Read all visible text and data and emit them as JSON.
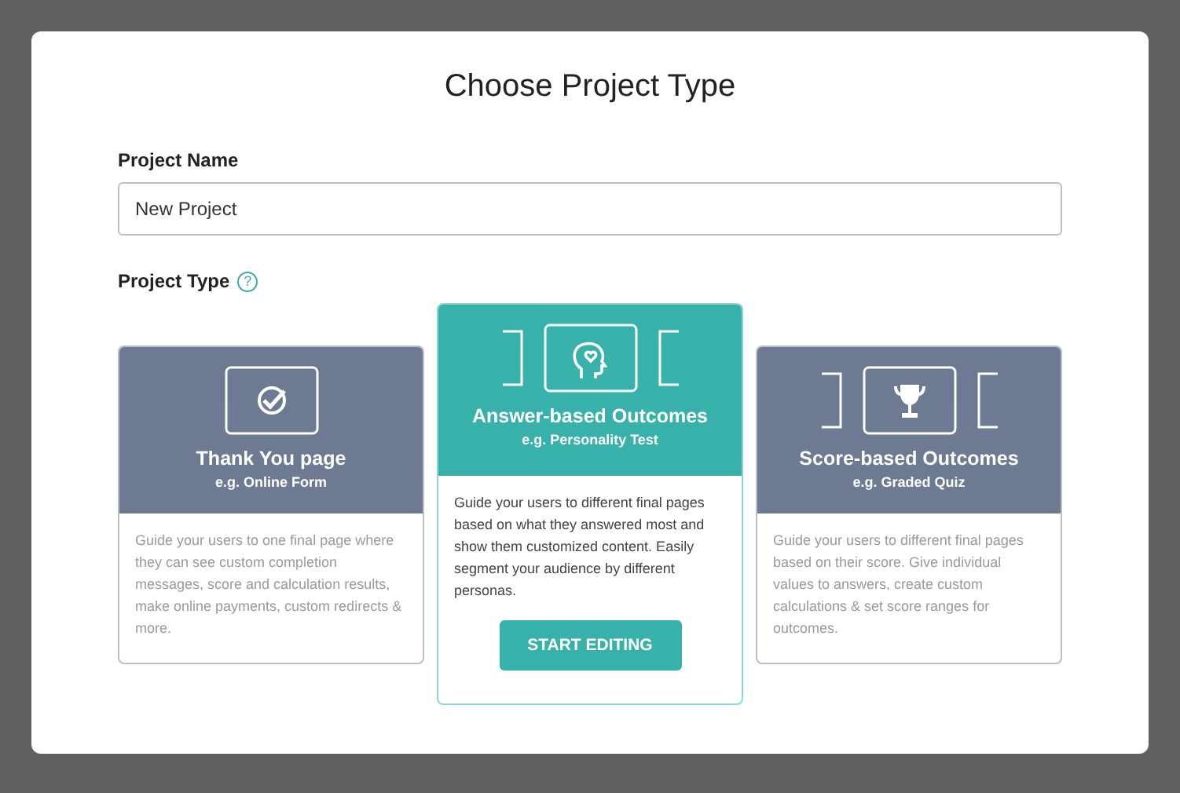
{
  "dialog": {
    "title": "Choose Project Type"
  },
  "project_name": {
    "label": "Project Name",
    "value": "New Project"
  },
  "project_type": {
    "label": "Project Type",
    "help": "?"
  },
  "types": [
    {
      "kind": "check",
      "title": "Thank You page",
      "example": "e.g. Online Form",
      "description": "Guide your users to one final page where they can see custom completion messages, score and calculation results, make online payments, custom redirects & more.",
      "selected": false
    },
    {
      "kind": "head",
      "title": "Answer-based Outcomes",
      "example": "e.g. Personality Test",
      "description": "Guide your users to different final pages based on what they answered most and show them customized content. Easily segment your audience by different personas.",
      "selected": true
    },
    {
      "kind": "trophy",
      "title": "Score-based Outcomes",
      "example": "e.g. Graded Quiz",
      "description": "Guide your users to different final pages based on their score. Give individual values to answers, create custom calculations & set score ranges for outcomes.",
      "selected": false
    }
  ],
  "action_button": "START EDITING"
}
